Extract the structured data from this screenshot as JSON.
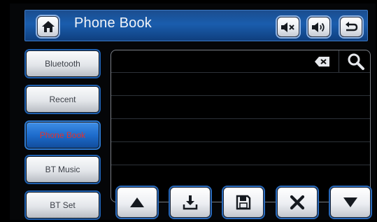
{
  "header": {
    "title": "Phone Book"
  },
  "sidebar": {
    "items": [
      {
        "label": "Bluetooth",
        "active": false
      },
      {
        "label": "Recent",
        "active": false
      },
      {
        "label": "Phone Book",
        "active": true
      },
      {
        "label": "BT Music",
        "active": false
      },
      {
        "label": "BT Set",
        "active": false
      }
    ]
  },
  "icons": {
    "home": "home-icon",
    "mute": "mute-icon",
    "volume": "volume-icon",
    "back": "back-icon",
    "backspace": "backspace-icon",
    "search": "search-icon",
    "up": "arrow-up-icon",
    "download": "download-icon",
    "save": "save-icon",
    "delete": "close-icon",
    "down": "arrow-down-icon"
  },
  "colors": {
    "accent": "#1a5dad",
    "active_text": "#e0322f"
  }
}
